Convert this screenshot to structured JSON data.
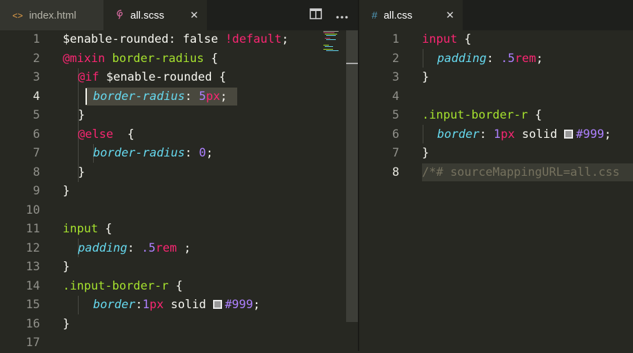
{
  "tabs_left": [
    {
      "label": "index.html",
      "icon": "<>",
      "active": false
    },
    {
      "label": "all.scss",
      "icon": "sass-icon",
      "active": true
    }
  ],
  "tab_actions": {
    "split_icon": "split-editor-icon",
    "more_icon": "more-actions-icon"
  },
  "tabs_right": [
    {
      "label": "all.css",
      "icon": "#",
      "active": true
    }
  ],
  "close_glyph": "✕",
  "scss_line_numbers": [
    "1",
    "2",
    "3",
    "4",
    "5",
    "6",
    "7",
    "8",
    "9",
    "10",
    "11",
    "12",
    "13",
    "14",
    "15",
    "16",
    "17"
  ],
  "css_line_numbers": [
    "1",
    "2",
    "3",
    "4",
    "5",
    "6",
    "7",
    "8"
  ],
  "scss": {
    "l1": {
      "v": "$enable-rounded",
      "colon": ":",
      "val": " false ",
      "imp": "!default",
      "semi": ";"
    },
    "l2": {
      "kw": "@mixin",
      "name": " border-radius",
      "brace": " {"
    },
    "l3": {
      "kw": "@if",
      "var": " $enable-rounded",
      "brace": " {"
    },
    "l4": {
      "prop": "border-radius",
      "colon": ":",
      "num": " 5",
      "unit": "px",
      "semi": ";"
    },
    "l5": "}",
    "l6": {
      "kw": "@else",
      "brace": "  {"
    },
    "l7": {
      "prop": "border-radius",
      "colon": ":",
      "num": " 0",
      "semi": ";"
    },
    "l8": "}",
    "l9": "}",
    "l11": {
      "sel": "input",
      "brace": " {"
    },
    "l12": {
      "prop": "padding",
      "colon": ":",
      "num": " .5",
      "unit": "rem",
      "semi": " ;"
    },
    "l13": "}",
    "l14": {
      "sel": ".input-border-r",
      "brace": " {"
    },
    "l15": {
      "prop": "border",
      "colon": ":",
      "num": "1",
      "unit": "px",
      "val": " solid ",
      "hex": "#999",
      "semi": ";"
    },
    "l16": "}"
  },
  "css": {
    "l1": {
      "sel": "input",
      "brace": " {"
    },
    "l2": {
      "prop": "padding",
      "colon": ":",
      "num": " .5",
      "unit": "rem",
      "semi": ";"
    },
    "l3": "}",
    "l5": {
      "sel": ".input-border-r",
      "brace": " {"
    },
    "l6": {
      "prop": "border",
      "colon": ":",
      "num": " 1",
      "unit": "px",
      "val": " solid ",
      "hex": "#999",
      "semi": ";"
    },
    "l7": "}",
    "l8": "/*# sourceMappingURL=all.css"
  },
  "colors": {
    "swatch": "#999999",
    "background": "#272822"
  }
}
